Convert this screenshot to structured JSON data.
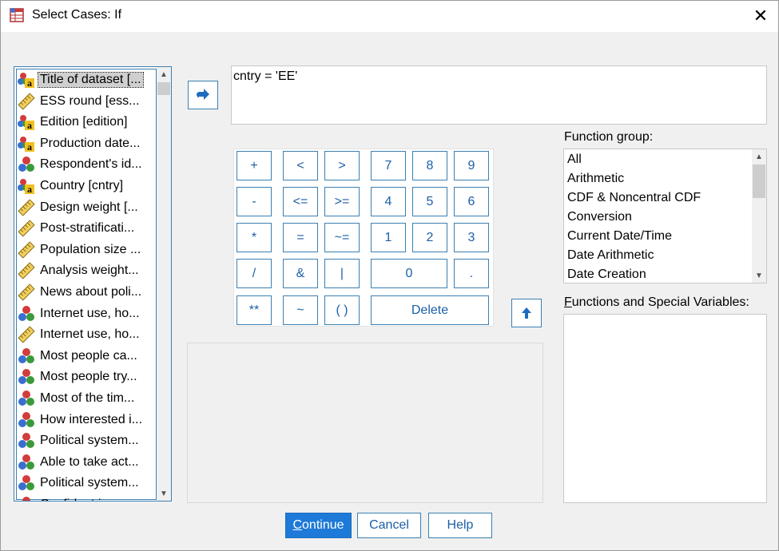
{
  "window": {
    "title": "Select Cases: If",
    "close_symbol": "✕"
  },
  "variables": [
    {
      "label": "Title of dataset [...",
      "icon": "nominal-string-icon",
      "selected": true
    },
    {
      "label": "ESS round [ess...",
      "icon": "scale-icon"
    },
    {
      "label": "Edition [edition]",
      "icon": "nominal-string-icon"
    },
    {
      "label": "Production date...",
      "icon": "nominal-string-icon"
    },
    {
      "label": "Respondent's id...",
      "icon": "nominal-icon"
    },
    {
      "label": "Country [cntry]",
      "icon": "nominal-string-icon"
    },
    {
      "label": "Design weight [...",
      "icon": "scale-icon"
    },
    {
      "label": "Post-stratificati...",
      "icon": "scale-icon"
    },
    {
      "label": "Population size ...",
      "icon": "scale-icon"
    },
    {
      "label": "Analysis weight...",
      "icon": "scale-icon"
    },
    {
      "label": "News about poli...",
      "icon": "scale-icon"
    },
    {
      "label": "Internet use, ho...",
      "icon": "nominal-icon"
    },
    {
      "label": "Internet use, ho...",
      "icon": "scale-icon"
    },
    {
      "label": "Most people ca...",
      "icon": "nominal-icon"
    },
    {
      "label": "Most people try...",
      "icon": "nominal-icon"
    },
    {
      "label": "Most of the tim...",
      "icon": "nominal-icon"
    },
    {
      "label": "How interested i...",
      "icon": "nominal-icon"
    },
    {
      "label": "Political system...",
      "icon": "nominal-icon"
    },
    {
      "label": "Able to take act...",
      "icon": "nominal-icon"
    },
    {
      "label": "Political system...",
      "icon": "nominal-icon"
    },
    {
      "label": "Confident in...",
      "icon": "nominal-icon"
    }
  ],
  "expression": "cntry = 'EE'",
  "keypad": {
    "plus": "+",
    "lt": "<",
    "gt": ">",
    "k7": "7",
    "k8": "8",
    "k9": "9",
    "minus": "-",
    "le": "<=",
    "ge": ">=",
    "k4": "4",
    "k5": "5",
    "k6": "6",
    "mult": "*",
    "eq": "=",
    "ne": "~=",
    "k1": "1",
    "k2": "2",
    "k3": "3",
    "div": "/",
    "and": "&",
    "or": "|",
    "k0": "0",
    "dot": ".",
    "pow": "**",
    "not": "~",
    "paren": "( )",
    "delete": "Delete"
  },
  "function_group": {
    "label": "Function group:",
    "items": [
      "All",
      "Arithmetic",
      "CDF & Noncentral CDF",
      "Conversion",
      "Current Date/Time",
      "Date Arithmetic",
      "Date Creation"
    ]
  },
  "functions_special": {
    "label_first": "F",
    "label_rest": "unctions and Special Variables:"
  },
  "buttons": {
    "continue_first": "C",
    "continue_rest": "ontinue",
    "cancel": "Cancel",
    "help": "Help"
  },
  "colors": {
    "accent": "#1e7ad8",
    "border_blue": "#3c7fb1",
    "key_text": "#1c5fa6"
  }
}
